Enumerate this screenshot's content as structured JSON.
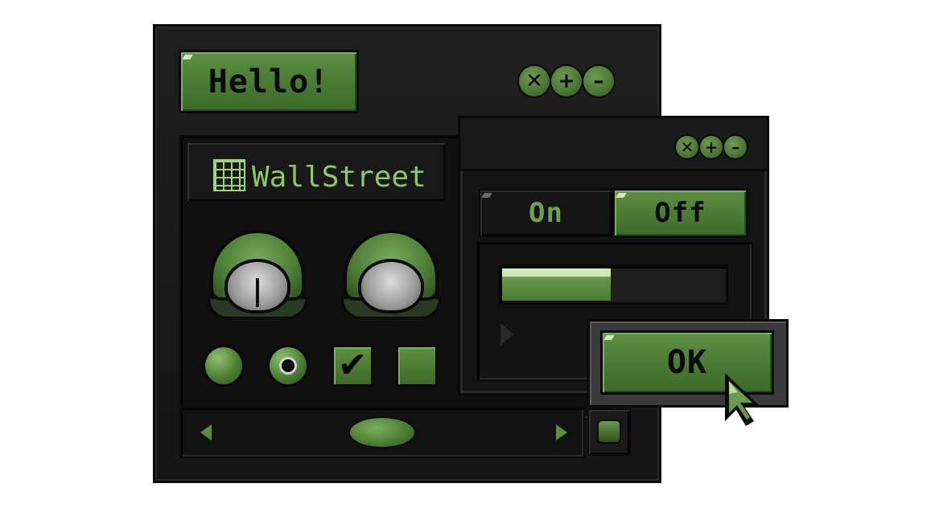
{
  "main_window": {
    "hello_label": "Hello!",
    "title_controls": [
      {
        "icon": "close-icon",
        "glyph": "✕"
      },
      {
        "icon": "maximize-icon",
        "glyph": "+"
      },
      {
        "icon": "minimize-icon",
        "glyph": "–"
      }
    ],
    "tab_label": "WallStreet",
    "checkbox_glyph": "✔"
  },
  "sub_window": {
    "on_label": "On",
    "off_label": "Off",
    "progress_fraction": 0.49
  },
  "dialog": {
    "ok_label": "OK"
  },
  "colors": {
    "accent_green": "#4a7a34",
    "text_green": "#8ec76a",
    "background": "#151515"
  }
}
